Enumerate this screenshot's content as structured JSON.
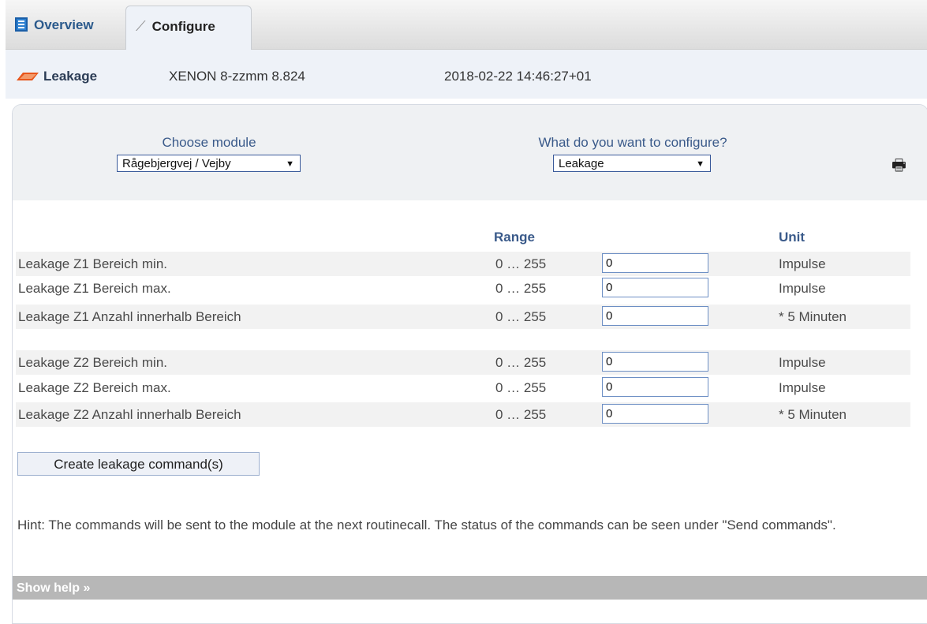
{
  "tabs": [
    {
      "label": "Overview",
      "icon": "document-icon",
      "active": false
    },
    {
      "label": "Configure",
      "icon": "wrench-icon",
      "active": true
    }
  ],
  "header": {
    "module": "Leakage",
    "device": "XENON 8-zzmm 8.824",
    "timestamp": "2018-02-22 14:46:27+01"
  },
  "controls": {
    "choose_module_label": "Choose module",
    "choose_module_value": "Rågebjergvej / Vejby",
    "configure_label": "What do you want to configure?",
    "configure_value": "Leakage",
    "print_icon": "printer-icon"
  },
  "table": {
    "headers": {
      "range": "Range",
      "unit": "Unit"
    },
    "rows": [
      {
        "label": "Leakage Z1 Bereich min.",
        "range": "0 … 255",
        "value": "0",
        "unit": "Impulse"
      },
      {
        "label": "Leakage Z1 Bereich max.",
        "range": "0 … 255",
        "value": "0",
        "unit": "Impulse"
      },
      {
        "label": "Leakage Z1 Anzahl innerhalb Bereich",
        "range": "0 … 255",
        "value": "0",
        "unit": "* 5 Minuten"
      },
      {
        "label": "Leakage Z2 Bereich min.",
        "range": "0 … 255",
        "value": "0",
        "unit": "Impulse"
      },
      {
        "label": "Leakage Z2 Bereich max.",
        "range": "0 … 255",
        "value": "0",
        "unit": "Impulse"
      },
      {
        "label": "Leakage Z2 Anzahl innerhalb Bereich",
        "range": "0 … 255",
        "value": "0",
        "unit": "* 5 Minuten"
      }
    ]
  },
  "create_button": "Create leakage command(s)",
  "hint": "Hint: The commands will be sent to the module at the next routinecall. The status of the commands can be seen under \"Send commands\".",
  "help_link": "Show help »",
  "colors": {
    "accent": "#3a5a8a",
    "leak_icon": "#e8561c"
  }
}
